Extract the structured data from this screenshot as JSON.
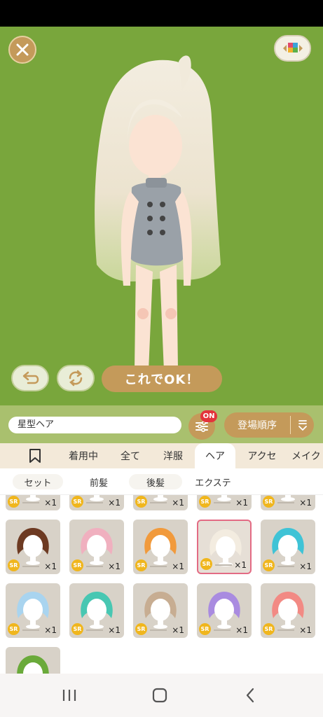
{
  "stage": {
    "background_color": "#79a63c"
  },
  "toolbar": {
    "close_icon": "close-icon",
    "background_toggle_icon": "background-palette-icon",
    "undo_icon": "undo-icon",
    "rotate_icon": "rotate-icon",
    "ok_label": "これでOK！"
  },
  "filter": {
    "search_value": "星型ヘア",
    "filter_icon": "sliders-icon",
    "filter_badge": "ON",
    "sort_label": "登場順序",
    "sort_order_icon": "sort-order-icon"
  },
  "tabs": [
    {
      "label": "",
      "icon": "bookmark-icon"
    },
    {
      "label": "着用中"
    },
    {
      "label": "全て"
    },
    {
      "label": "洋服"
    },
    {
      "label": "ヘア",
      "active": true
    },
    {
      "label": "アクセ"
    },
    {
      "label": "メイク"
    }
  ],
  "subtabs": [
    {
      "label": "セット"
    },
    {
      "label": "前髪"
    },
    {
      "label": "後髪"
    },
    {
      "label": "エクステ"
    }
  ],
  "items": [
    {
      "rarity": "SR",
      "qty": "×1",
      "hair_color": "#6d3a22",
      "partial": true
    },
    {
      "rarity": "SR",
      "qty": "×1",
      "hair_color": "#c9bfb3",
      "partial": true
    },
    {
      "rarity": "SR",
      "qty": "×1",
      "hair_color": "#d1c9bd",
      "partial": true
    },
    {
      "rarity": "SR",
      "qty": "×1",
      "hair_color": "#b27ec6",
      "partial": true
    },
    {
      "rarity": "SR",
      "qty": "×1",
      "hair_color": "#b590c4",
      "partial": true
    },
    {
      "rarity": "SR",
      "qty": "×1",
      "hair_color": "#6d3a22"
    },
    {
      "rarity": "SR",
      "qty": "×1",
      "hair_color": "#f0b0bf"
    },
    {
      "rarity": "SR",
      "qty": "×1",
      "hair_color": "#f19a3c"
    },
    {
      "rarity": "SR",
      "qty": "×1",
      "hair_color": "#f3ece0",
      "selected": true
    },
    {
      "rarity": "SR",
      "qty": "×1",
      "hair_color": "#3fc3d6"
    },
    {
      "rarity": "SR",
      "qty": "×1",
      "hair_color": "#a9d4ef"
    },
    {
      "rarity": "SR",
      "qty": "×1",
      "hair_color": "#48c7b2"
    },
    {
      "rarity": "SR",
      "qty": "×1",
      "hair_color": "#c7ad92"
    },
    {
      "rarity": "SR",
      "qty": "×1",
      "hair_color": "#a98be0"
    },
    {
      "rarity": "SR",
      "qty": "×1",
      "hair_color": "#f28a84"
    },
    {
      "rarity": "",
      "qty": "",
      "hair_color": "#6aaa3a",
      "partial": true
    }
  ],
  "nav": {
    "recents_icon": "recents-icon",
    "home_icon": "home-icon",
    "back_icon": "back-icon"
  }
}
